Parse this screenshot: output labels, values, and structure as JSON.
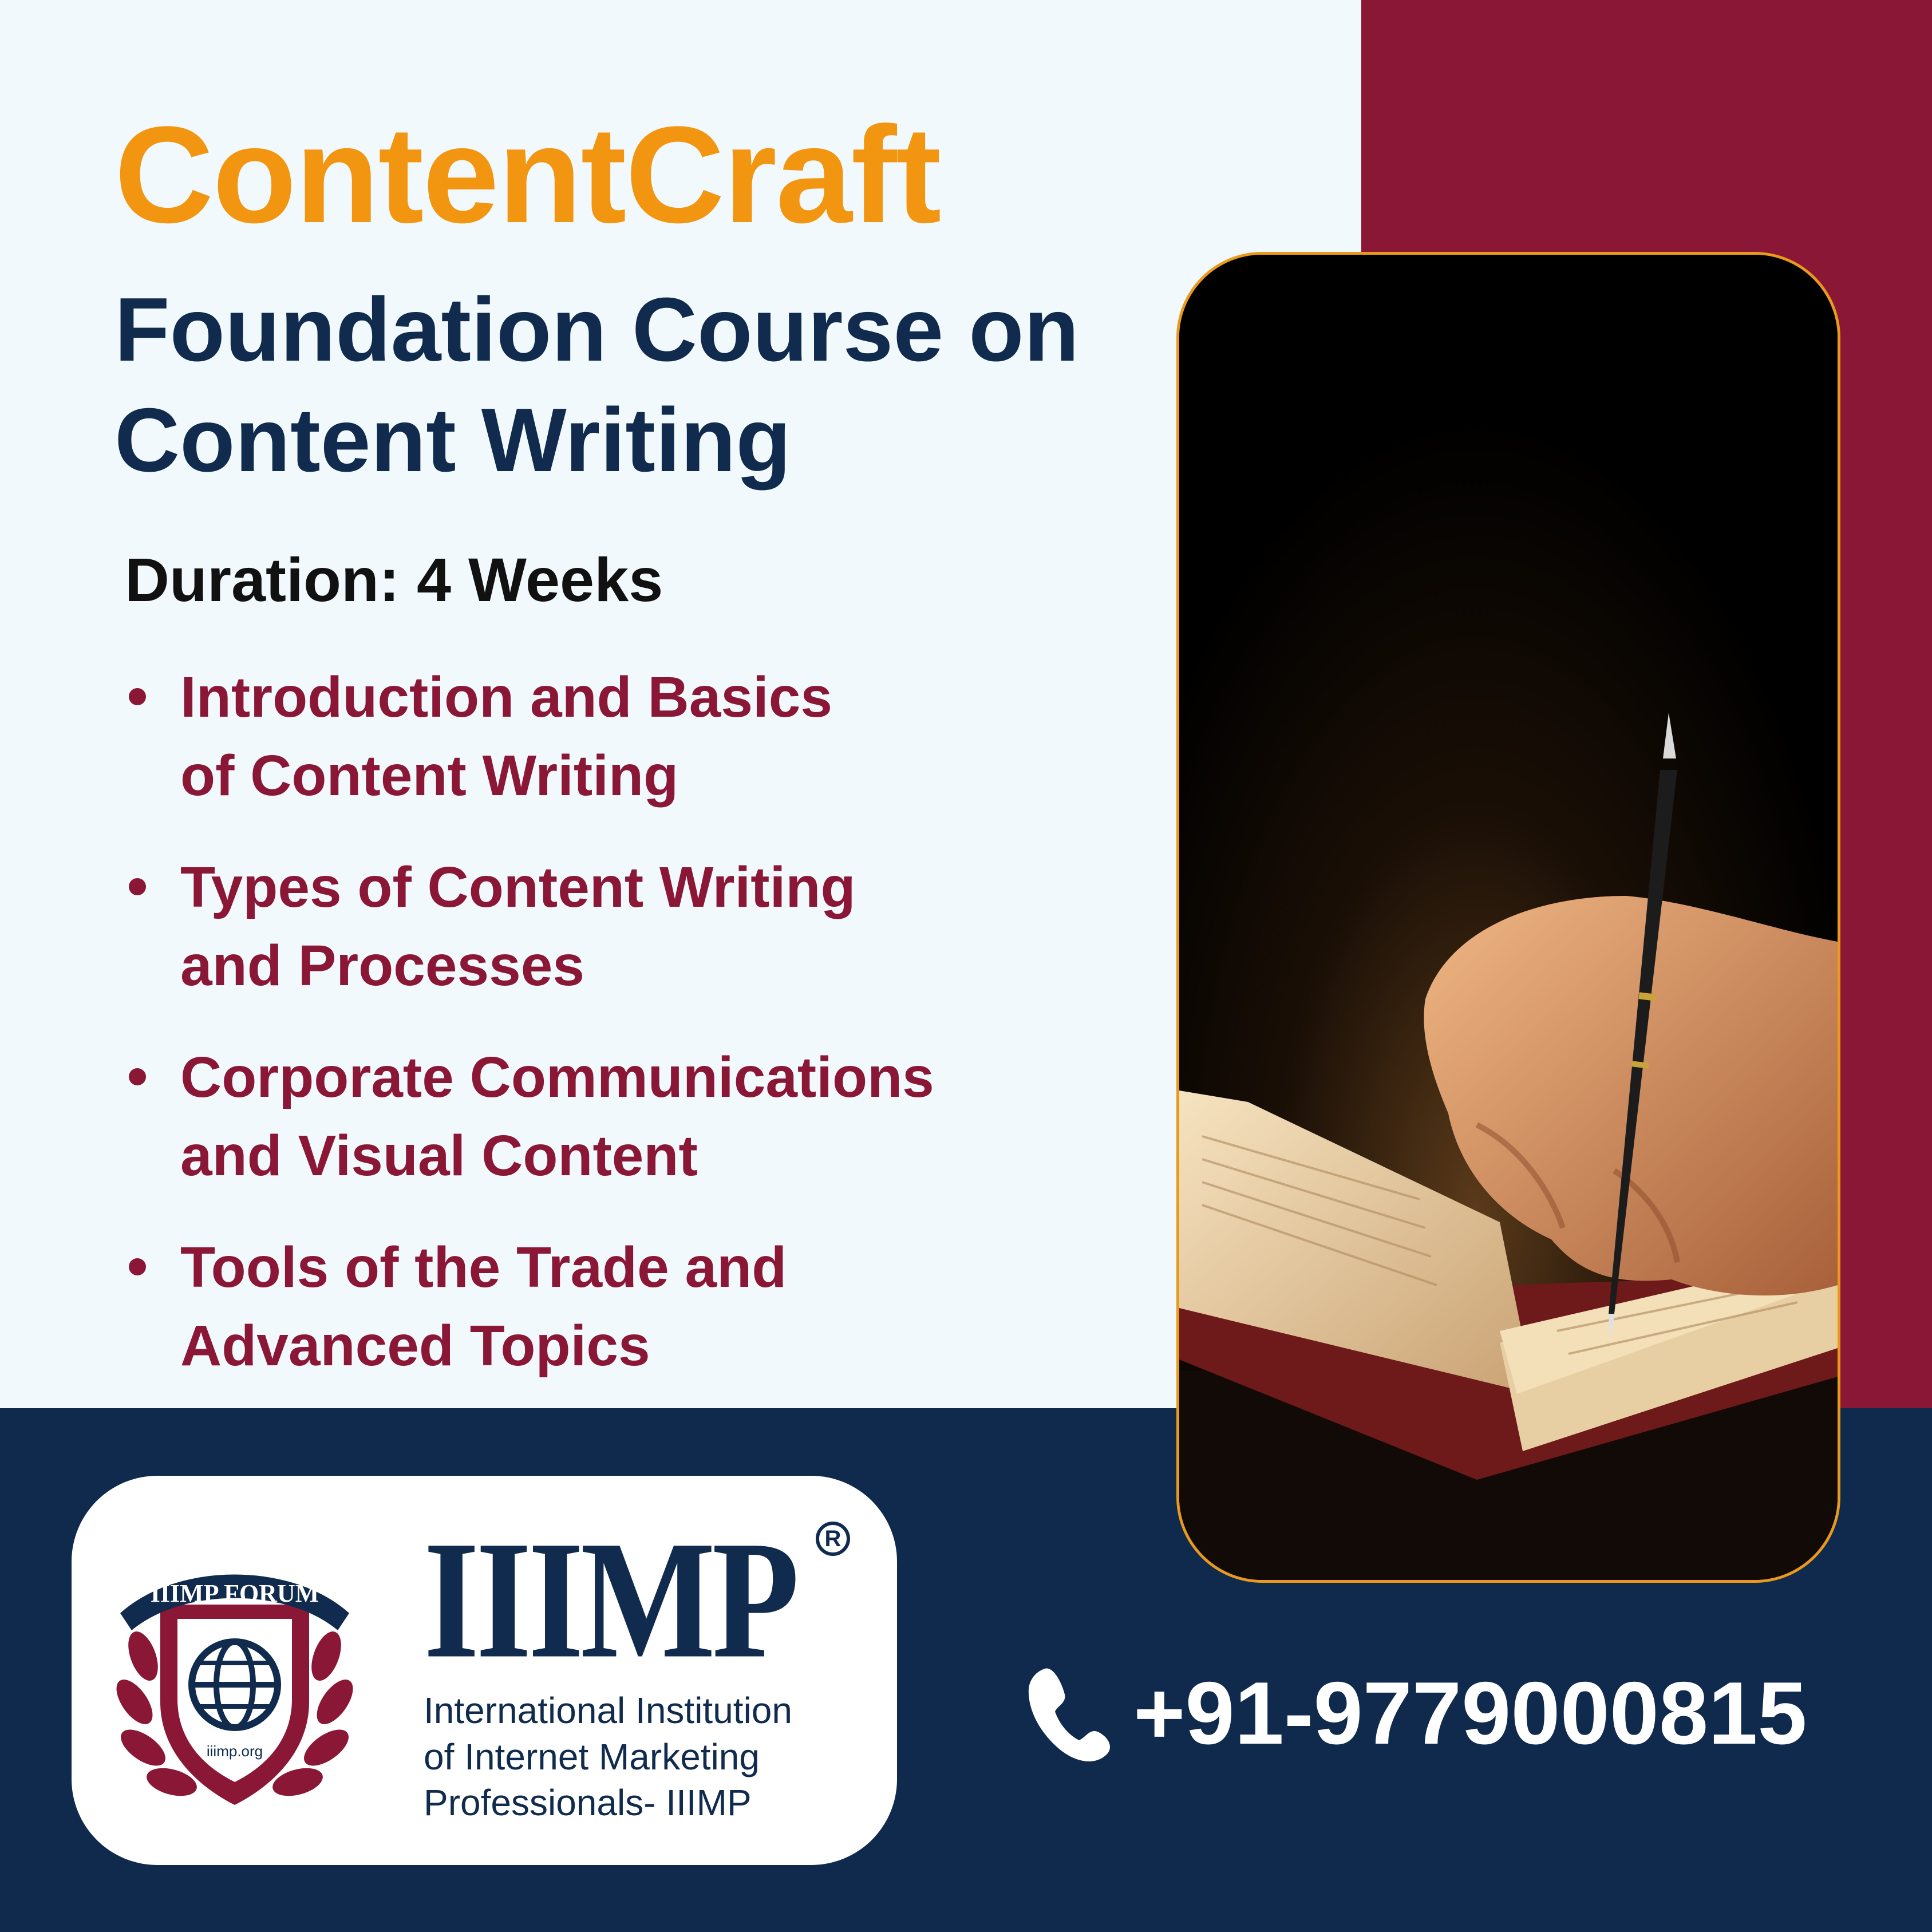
{
  "header": {
    "brand": "ContentCraft",
    "subtitle_lines": [
      "Foundation Course on",
      "Content Writing"
    ],
    "duration": "Duration: 4 Weeks"
  },
  "topics": [
    {
      "lines": [
        "Introduction and Basics",
        "of Content Writing"
      ]
    },
    {
      "lines": [
        "Types of Content Writing",
        "and Processes"
      ]
    },
    {
      "lines": [
        "Corporate Communications",
        "and Visual Content"
      ]
    },
    {
      "lines": [
        "Tools of the Trade and",
        "Advanced Topics"
      ]
    }
  ],
  "photo": {
    "description_icon": "hand-writing-with-pen-icon"
  },
  "logo": {
    "emblem_banner": "IIIMP FORUM",
    "emblem_url": "iiimp.org",
    "wordmark": "IIIMP",
    "registered": "R",
    "institution_lines": [
      "International Institution",
      "of Internet Marketing",
      "Professionals- IIIMP"
    ]
  },
  "contact": {
    "phone_icon": "phone-icon",
    "phone": "+91-9779000815"
  },
  "colors": {
    "orange": "#f29611",
    "navy": "#102b4d",
    "maroon": "#8b1736",
    "light_bg": "#f1f9fc"
  }
}
